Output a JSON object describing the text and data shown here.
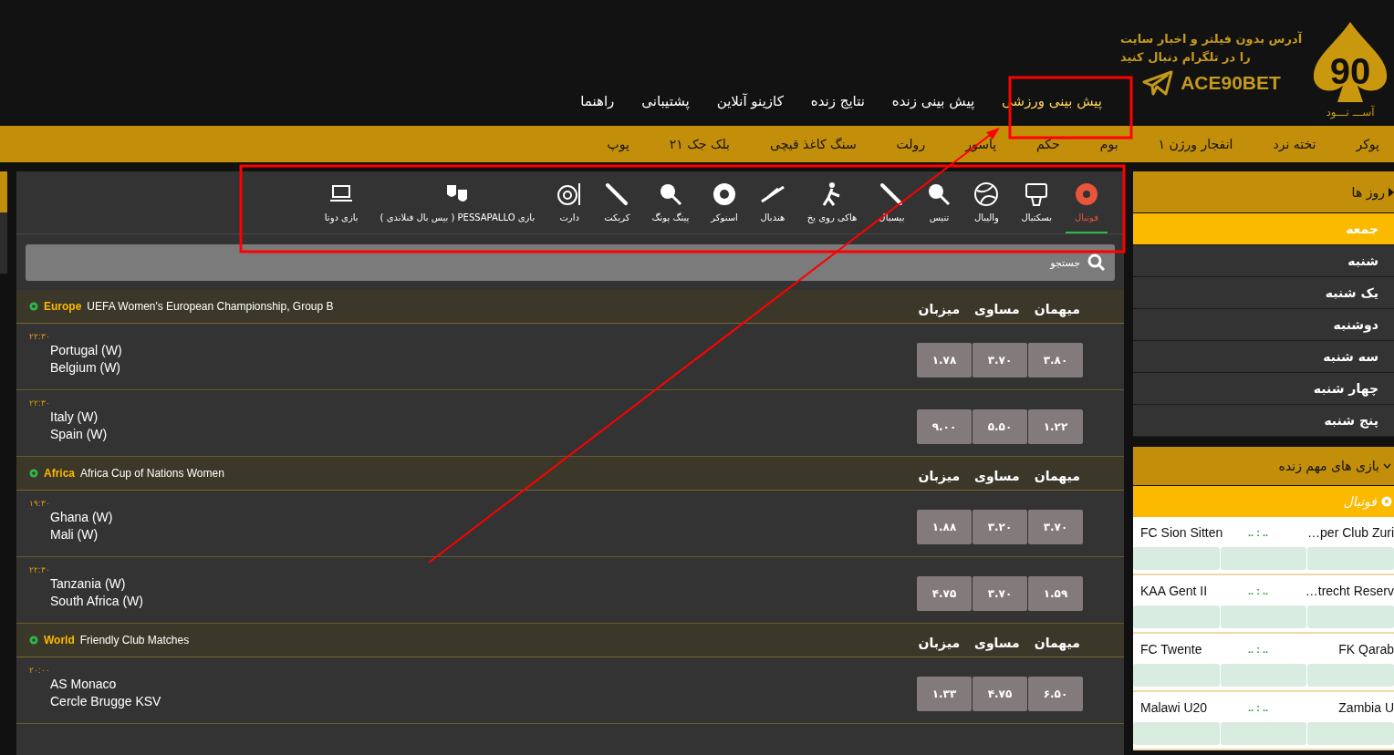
{
  "header": {
    "slogan_lines": [
      "آدرس بدون فیلتر و اخبار سایت",
      "را در تلگرام دنبال کنید"
    ],
    "telegram_handle": "ACE90BET",
    "logo_number": "90",
    "logo_text": "آســـ نـــود"
  },
  "main_nav": [
    {
      "label": "پیش بینی ورزشی",
      "selected": true
    },
    {
      "label": "پیش بینی زنده",
      "selected": false
    },
    {
      "label": "نتایج زنده",
      "selected": false
    },
    {
      "label": "کازینو آنلاین",
      "selected": false
    },
    {
      "label": "پشتیبانی",
      "selected": false
    },
    {
      "label": "راهنما",
      "selected": false
    }
  ],
  "games_bar": [
    "پوکر",
    "تخته نرد",
    "انفجار ورژن ۱",
    "بوم",
    "حکم",
    "پاسور",
    "رولت",
    "سنگ کاغذ قیچی",
    "بلک جک ۲۱",
    "پوپ"
  ],
  "sports": [
    {
      "label": "فوتبال",
      "selected": true
    },
    {
      "label": "بسکتبال",
      "selected": false
    },
    {
      "label": "والیبال",
      "selected": false
    },
    {
      "label": "تنیس",
      "selected": false
    },
    {
      "label": "بیسبال",
      "selected": false
    },
    {
      "label": "هاکی روی یخ",
      "selected": false
    },
    {
      "label": "هندبال",
      "selected": false
    },
    {
      "label": "اسنوکر",
      "selected": false
    },
    {
      "label": "پینگ پونگ",
      "selected": false
    },
    {
      "label": "کریکت",
      "selected": false
    },
    {
      "label": "دارت",
      "selected": false
    },
    {
      "label": "بازی PESSAPALLO ( بیس بال فنلاندی )",
      "selected": false
    },
    {
      "label": "بازی دوتا",
      "selected": false
    }
  ],
  "search": {
    "placeholder": "جستجو"
  },
  "leagues": [
    {
      "region": "Europe",
      "name": "UEFA Women's European Championship, Group B",
      "columns": [
        "میهمان",
        "مساوی",
        "میزبان"
      ],
      "matches": [
        {
          "time": "۲۲:۳۰",
          "home": "Portugal (W)",
          "away": "Belgium (W)",
          "odds": [
            "۳.۸۰",
            "۳.۷۰",
            "۱.۷۸"
          ]
        },
        {
          "time": "۲۲:۳۰",
          "home": "Italy (W)",
          "away": "Spain (W)",
          "odds": [
            "۱.۲۲",
            "۵.۵۰",
            "۹.۰۰"
          ]
        }
      ]
    },
    {
      "region": "Africa",
      "name": "Africa Cup of Nations Women",
      "columns": [
        "میهمان",
        "مساوی",
        "میزبان"
      ],
      "matches": [
        {
          "time": "۱۹:۳۰",
          "home": "Ghana (W)",
          "away": "Mali (W)",
          "odds": [
            "۳.۷۰",
            "۳.۲۰",
            "۱.۸۸"
          ]
        },
        {
          "time": "۲۲:۳۰",
          "home": "Tanzania (W)",
          "away": "South Africa (W)",
          "odds": [
            "۱.۵۹",
            "۳.۷۰",
            "۴.۷۵"
          ]
        }
      ]
    },
    {
      "region": "World",
      "name": "Friendly Club Matches",
      "columns": [
        "میهمان",
        "مساوی",
        "میزبان"
      ],
      "matches": [
        {
          "time": "۲۰:۰۰",
          "home": "AS Monaco",
          "away": "Cercle Brugge KSV",
          "odds": [
            "۶.۵۰",
            "۴.۷۵",
            "۱.۳۳"
          ]
        }
      ]
    }
  ],
  "days": {
    "title": "روز ها",
    "items": [
      {
        "label": "جمعه",
        "selected": true
      },
      {
        "label": "شنبه",
        "selected": false
      },
      {
        "label": "یک شنبه",
        "selected": false
      },
      {
        "label": "دوشنبه",
        "selected": false
      },
      {
        "label": "سه شنبه",
        "selected": false
      },
      {
        "label": "چهار شنبه",
        "selected": false
      },
      {
        "label": "پنج شنبه",
        "selected": false
      }
    ]
  },
  "live": {
    "title": "بازی های مهم زنده",
    "sport": "فوتبال",
    "matches": [
      {
        "home": "FC Sion Sitten",
        "score": ".. : ..",
        "away": "…per Club Zuri"
      },
      {
        "home": "KAA Gent II",
        "score": ".. : ..",
        "away": "…trecht Reserv"
      },
      {
        "home": "FC Twente",
        "score": ".. : ..",
        "away": "FK Qarab"
      },
      {
        "home": "Malawi U20",
        "score": ".. : ..",
        "away": "Zambia U"
      }
    ]
  }
}
